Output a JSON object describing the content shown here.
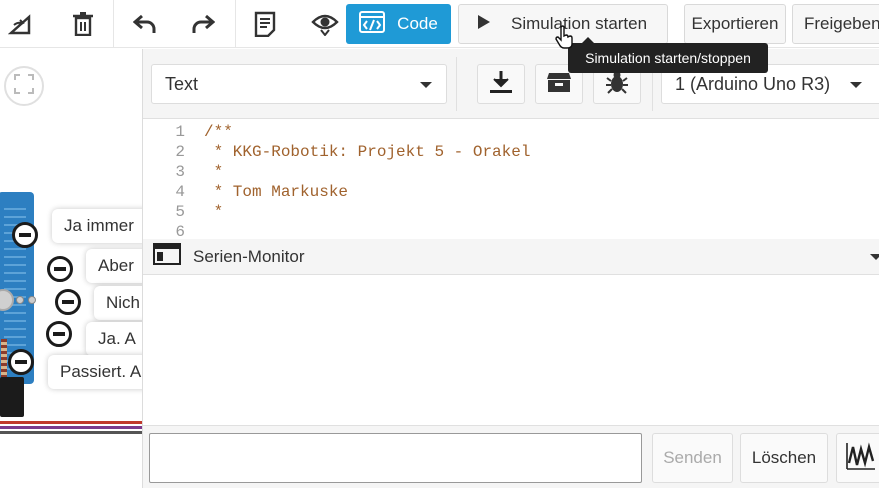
{
  "toolbar": {
    "rotate_icon": "rotate-icon",
    "delete_icon": "trash-icon",
    "undo_icon": "undo-icon",
    "redo_icon": "redo-icon",
    "notes_icon": "notes-icon",
    "view_icon": "eye-icon",
    "code_label": "Code",
    "simulate_label": "Simulation starten",
    "export_label": "Exportieren",
    "share_label": "Freigeben"
  },
  "tooltip": {
    "text": "Simulation starten/stoppen"
  },
  "canvas": {
    "bubbles": [
      "Ja immer",
      "Aber",
      "Nich",
      "Ja. A",
      "Passiert. A"
    ]
  },
  "editor": {
    "mode": "Text",
    "board": "1 (Arduino Uno R3)",
    "code_lines": [
      {
        "n": "1",
        "text": "/**"
      },
      {
        "n": "2",
        "text": " * KKG-Robotik: Projekt 5 - Orakel"
      },
      {
        "n": "3",
        "text": " *"
      },
      {
        "n": "4",
        "text": " * Tom Markuske"
      },
      {
        "n": "5",
        "text": " *"
      },
      {
        "n": "6",
        "text": ""
      }
    ]
  },
  "serial": {
    "title": "Serien-Monitor",
    "input_value": "",
    "send_label": "Senden",
    "clear_label": "Löschen"
  },
  "colors": {
    "accent": "#1f9ad6",
    "code_comment": "#a0622d"
  }
}
